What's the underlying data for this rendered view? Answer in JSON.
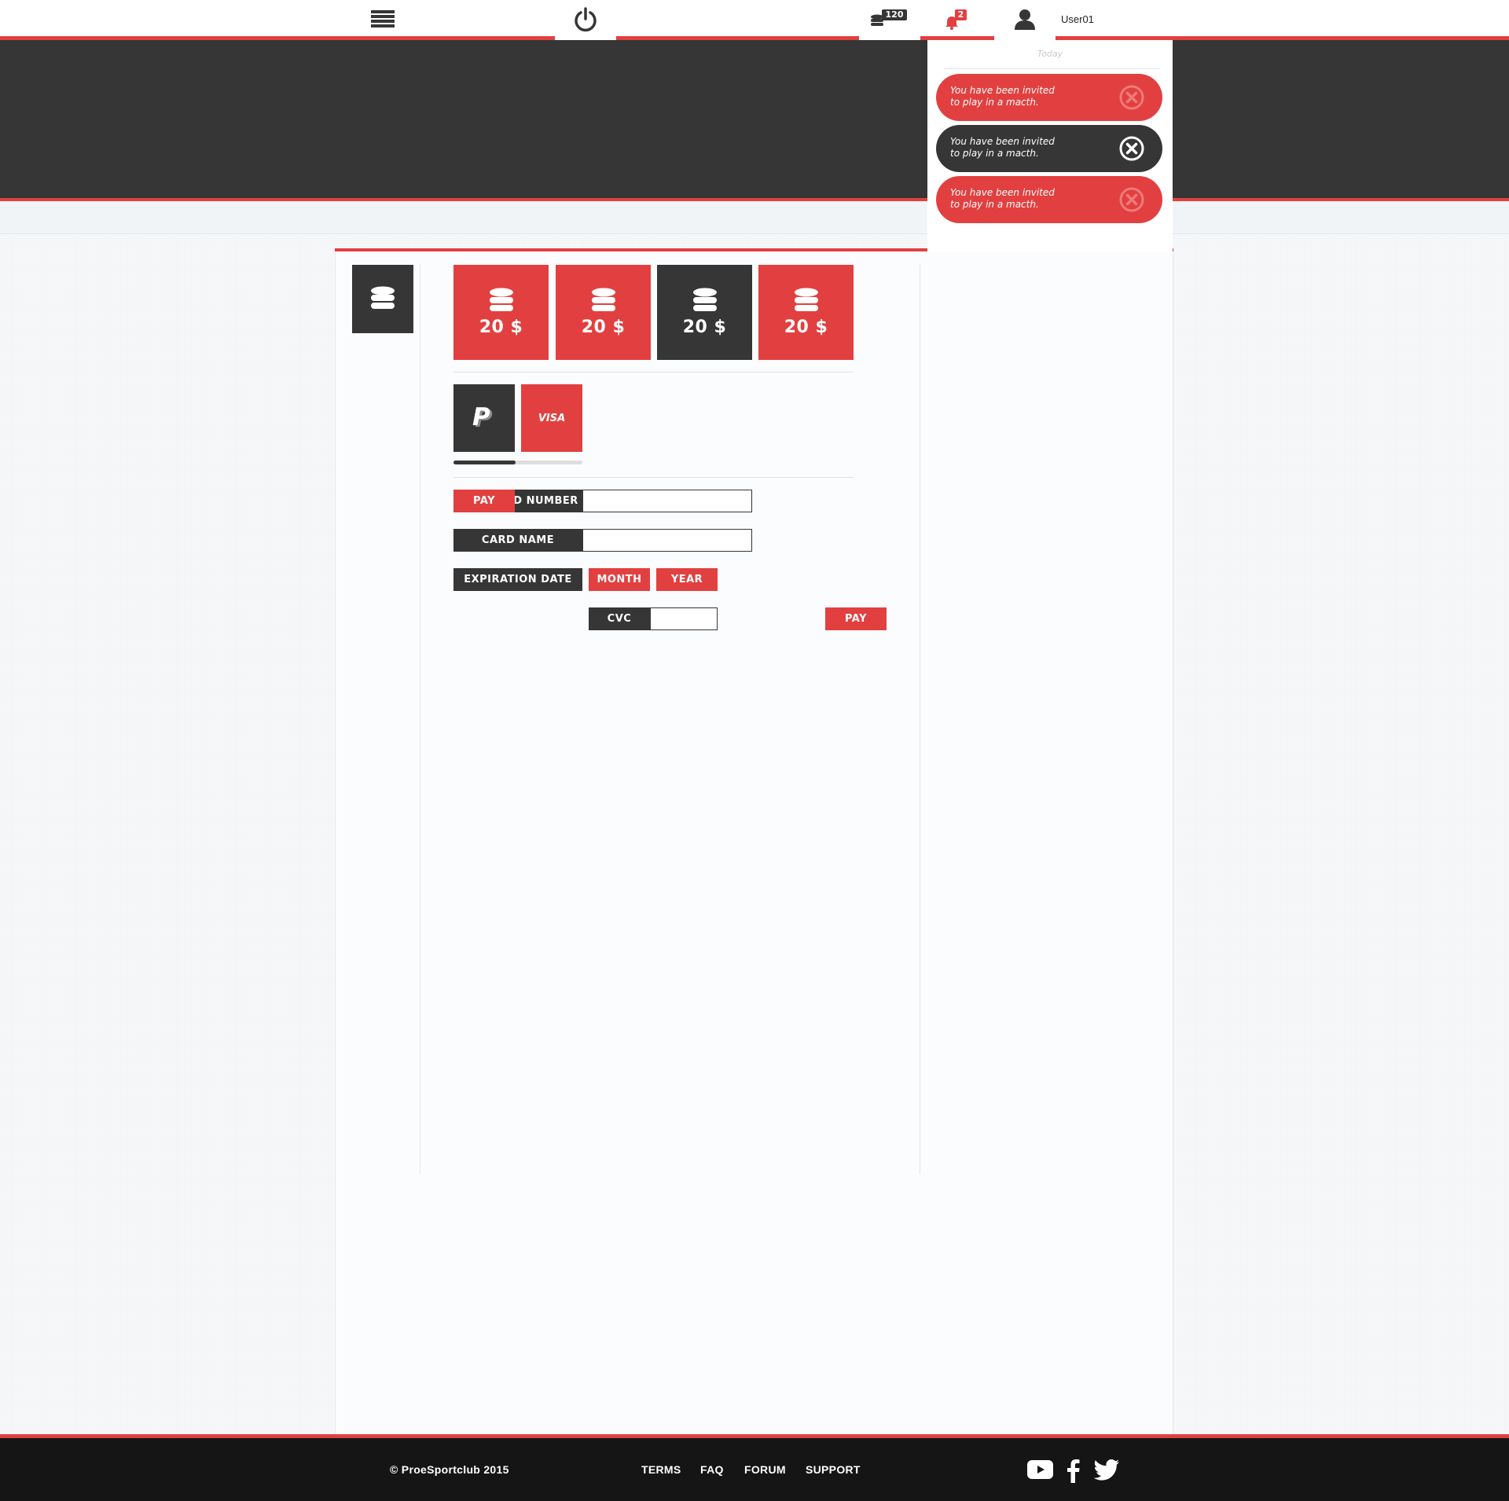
{
  "header": {
    "coins_badge": "120",
    "notifications_badge": "2",
    "username": "User01"
  },
  "notifications": {
    "day_label": "Today",
    "items": [
      {
        "line1": "You have been invited",
        "line2": "to play in a macth.",
        "state": "unread"
      },
      {
        "line1": "You have been invited",
        "line2": "to play in a macth.",
        "state": "hover"
      },
      {
        "line1": "You have been invited",
        "line2": "to play in a macth.",
        "state": "unread"
      }
    ]
  },
  "packages": [
    {
      "amount": "20 $",
      "selected": false
    },
    {
      "amount": "20 $",
      "selected": false
    },
    {
      "amount": "20 $",
      "selected": true
    },
    {
      "amount": "20 $",
      "selected": false
    }
  ],
  "payment_methods": {
    "visa_label": "VISA",
    "progress": 0.48
  },
  "form": {
    "pay_tab": "PAY",
    "card_number_label": "CARD NUMBER",
    "card_number_value": "",
    "card_name_label": "CARD NAME",
    "card_name_value": "",
    "expiration_label": "EXPIRATION DATE",
    "month_label": "MONTH",
    "year_label": "YEAR",
    "cvc_label": "CVC",
    "cvc_value": "",
    "pay_button": "PAY"
  },
  "footer": {
    "copyright": "© ProeSportclub 2015",
    "links": [
      "TERMS",
      "FAQ",
      "FORUM",
      "SUPPORT"
    ]
  },
  "colors": {
    "accent": "#e24040",
    "dark": "#363636",
    "footer": "#151515"
  }
}
